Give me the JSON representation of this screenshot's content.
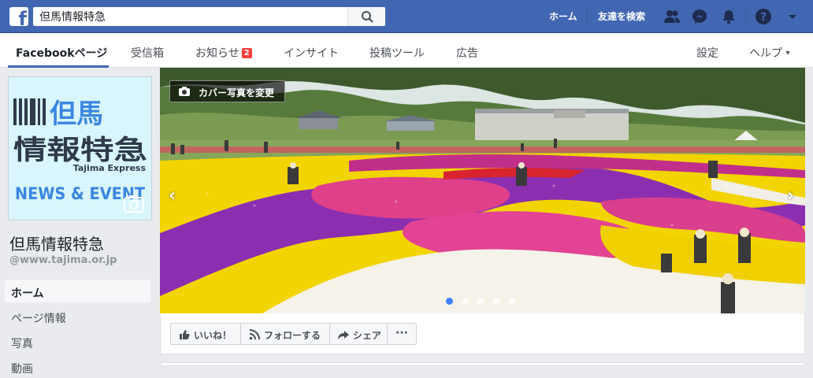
{
  "topbar": {
    "search_value": "但馬情報特急",
    "home_label": "ホーム",
    "find_friends_label": "友達を検索"
  },
  "nav": {
    "tabs": [
      {
        "label": "Facebookページ"
      },
      {
        "label": "受信箱"
      },
      {
        "label": "お知らせ",
        "badge": "2"
      },
      {
        "label": "インサイト"
      },
      {
        "label": "投稿ツール"
      },
      {
        "label": "広告"
      }
    ],
    "settings_label": "設定",
    "help_label": "ヘルプ",
    "help_caret": "▾"
  },
  "profile": {
    "logo_title": "但馬",
    "logo_subtitle": "情報特急",
    "logo_english": "Tajima Express",
    "logo_news": "NEWS & EVENT",
    "page_name": "但馬情報特急",
    "handle": "@www.tajima.or.jp"
  },
  "sidebar": {
    "items": [
      {
        "label": "ホーム"
      },
      {
        "label": "ページ情報"
      },
      {
        "label": "写真"
      },
      {
        "label": "動画"
      }
    ]
  },
  "cover": {
    "change_label": "カバー写真を変更",
    "prev_arrow": "‹",
    "next_arrow": "›",
    "slide_count": 5,
    "active_slide": 1
  },
  "actions": {
    "like_label": "いいね！",
    "follow_label": "フォローする",
    "share_label": "シェア",
    "more_label": "···"
  },
  "colors": {
    "brand": "#4267b2",
    "badge": "#fa3e3e",
    "slide_active": "#4080ff"
  }
}
